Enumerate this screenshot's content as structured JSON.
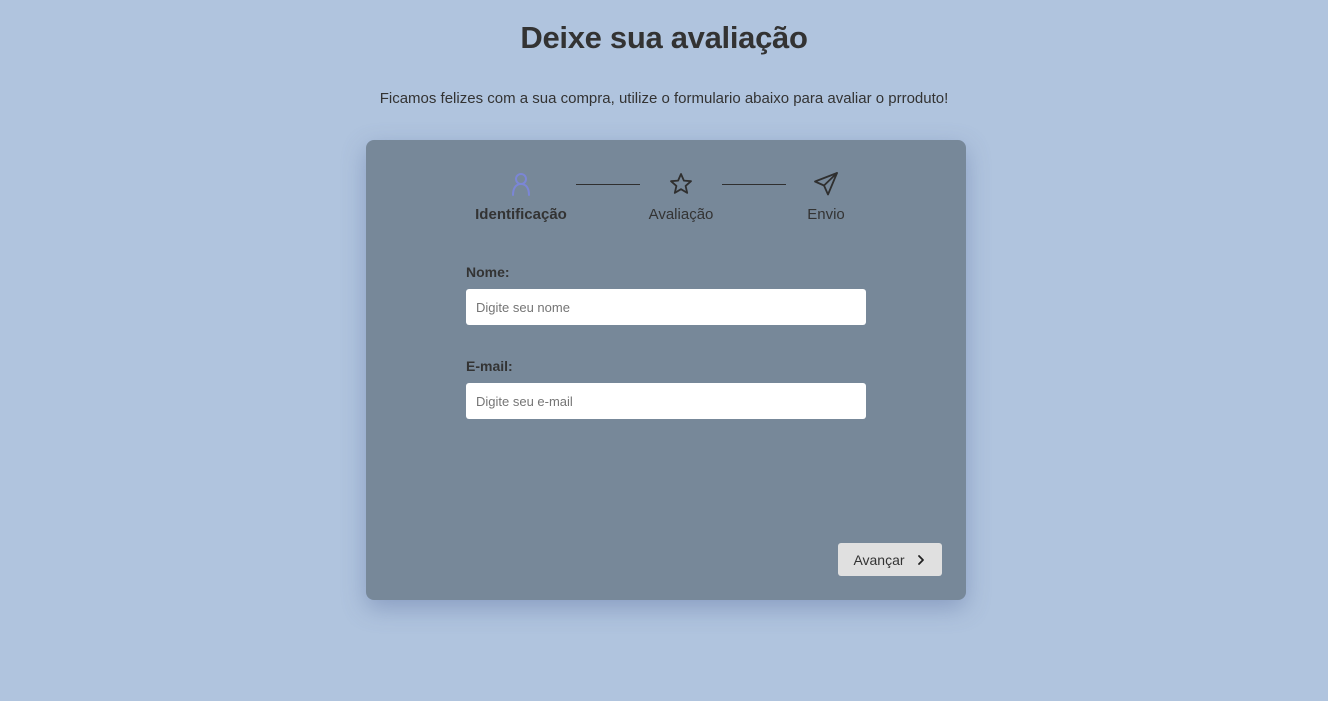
{
  "page": {
    "title": "Deixe sua avaliação",
    "subtitle": "Ficamos felizes com a sua compra, utilize o formulario abaixo para avaliar o prroduto!"
  },
  "steps": [
    {
      "label": "Identificação",
      "icon": "user-icon",
      "active": true
    },
    {
      "label": "Avaliação",
      "icon": "star-icon",
      "active": false
    },
    {
      "label": "Envio",
      "icon": "send-icon",
      "active": false
    }
  ],
  "form": {
    "name": {
      "label": "Nome:",
      "placeholder": "Digite seu nome",
      "value": ""
    },
    "email": {
      "label": "E-mail:",
      "placeholder": "Digite seu e-mail",
      "value": ""
    }
  },
  "actions": {
    "next_label": "Avançar",
    "next_icon": "chevron-right-icon"
  },
  "colors": {
    "background": "#b0c4de",
    "card": "#778899",
    "active_step": "#7b86d6",
    "text": "#333333",
    "button": "#e0e0e0"
  }
}
